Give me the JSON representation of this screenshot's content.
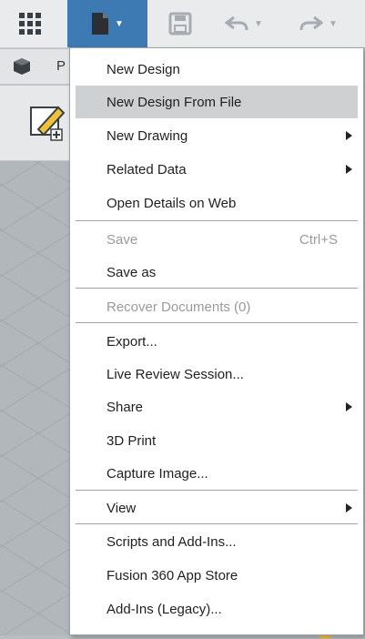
{
  "toolbar": {
    "grid_icon": "app-grid-icon",
    "file_icon": "file-icon",
    "save_icon": "floppy-save-icon",
    "undo_icon": "undo-arrow-icon",
    "redo_icon": "redo-arrow-icon",
    "active_color": "#3d79b3"
  },
  "browser": {
    "label": "P",
    "icon": "cube-icon"
  },
  "file_menu": {
    "items": [
      {
        "label": "New Design"
      },
      {
        "label": "New Design From File",
        "highlighted": true
      },
      {
        "label": "New Drawing",
        "submenu": true
      },
      {
        "label": "Related Data",
        "submenu": true
      },
      {
        "label": "Open Details on Web"
      },
      {
        "label": "Save",
        "shortcut": "Ctrl+S",
        "disabled": true
      },
      {
        "label": "Save as"
      },
      {
        "label": "Recover Documents (0)",
        "disabled": true
      },
      {
        "label": "Export..."
      },
      {
        "label": "Live Review Session..."
      },
      {
        "label": "Share",
        "submenu": true
      },
      {
        "label": "3D Print"
      },
      {
        "label": "Capture Image..."
      },
      {
        "label": "View",
        "submenu": true
      },
      {
        "label": "Scripts and Add-Ins..."
      },
      {
        "label": "Fusion 360 App Store"
      },
      {
        "label": "Add-Ins (Legacy)..."
      }
    ]
  }
}
